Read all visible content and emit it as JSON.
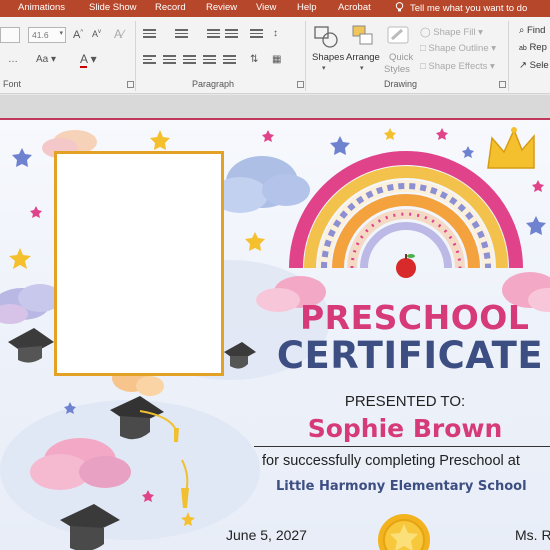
{
  "ribbon": {
    "tabs": [
      "Animations",
      "Slide Show",
      "Record",
      "Review",
      "View",
      "Help",
      "Acrobat"
    ],
    "tell_me": "Tell me what you want to do",
    "font_size": "41.6",
    "groups": {
      "font": "Font",
      "paragraph": "Paragraph",
      "drawing": "Drawing"
    },
    "drawing": {
      "shapes": "Shapes",
      "arrange": "Arrange",
      "quick_styles_1": "Quick",
      "quick_styles_2": "Styles",
      "shape_fill": "Shape Fill",
      "shape_outline": "Shape Outline",
      "shape_effects": "Shape Effects"
    },
    "editing": {
      "find": "Find",
      "replace": "Rep",
      "select": "Sele"
    }
  },
  "certificate": {
    "title_line1": "PRESCHOOL",
    "title_line2": "CERTIFICATE",
    "presented_to": "PRESENTED TO:",
    "recipient": "Sophie Brown",
    "description": "for successfully completing Preschool at",
    "school": "Little Harmony Elementary School",
    "date": "June 5, 2027",
    "signer": "Ms. R"
  },
  "colors": {
    "ribbon_tab_bar": "#b7472a",
    "title_pink": "#d63a78",
    "title_navy": "#3d4f82",
    "frame_gold": "#e3a126"
  }
}
